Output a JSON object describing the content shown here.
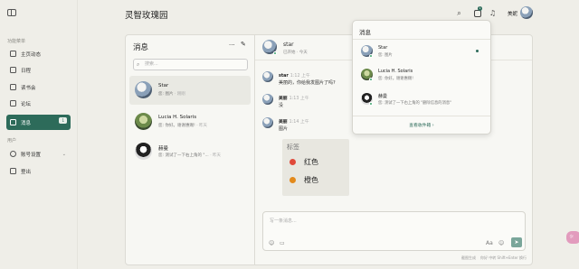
{
  "app": {
    "title": "灵智玫瑰园",
    "username": "美妮",
    "notif_count": "1"
  },
  "sidebar": {
    "section_main": "功能菜单",
    "items": [
      {
        "label": "主页动态",
        "icon": "home-icon"
      },
      {
        "label": "日程",
        "icon": "calendar-icon"
      },
      {
        "label": "读书会",
        "icon": "book-icon"
      },
      {
        "label": "论坛",
        "icon": "forum-icon"
      },
      {
        "label": "消息",
        "icon": "message-icon",
        "badge": "1",
        "active": true
      }
    ],
    "section_user": "用户",
    "user_items": [
      {
        "label": "账号设置",
        "icon": "user-settings-icon"
      },
      {
        "label": "登出",
        "icon": "logout-icon"
      }
    ]
  },
  "list": {
    "title": "消息",
    "search_placeholder": "搜索...",
    "conversations": [
      {
        "name": "Star",
        "preview": "您: 图片",
        "time": "· 刚刚"
      },
      {
        "name": "Lucia H. Solaris",
        "preview": "您: 你好。谢谢惠赐!",
        "time": "· 昨天"
      },
      {
        "name": "赫曼",
        "preview": "您: 测试了一下右上角的 \"...",
        "time": "· 昨天"
      }
    ]
  },
  "chat": {
    "name": "star",
    "status": "已开始 · 今天",
    "messages": [
      {
        "name": "star",
        "time": "1:12 上午",
        "text": "美丽的，你给我发图片了吗?"
      },
      {
        "name": "美丽",
        "time": "1:13 上午",
        "text": "没"
      },
      {
        "name": "美丽",
        "time": "1:14 上午",
        "text": "图片"
      }
    ],
    "tag_card": {
      "title": "标签",
      "tags": [
        {
          "label": "红色",
          "color": "#e04a3a"
        },
        {
          "label": "橙色",
          "color": "#e38a1c"
        }
      ]
    },
    "composer_placeholder": "写一条消息...",
    "footer_left": "截图生成",
    "footer_right": "你好 中转 Shift+Enter 换行"
  },
  "popup": {
    "title": "消息",
    "items": [
      {
        "name": "Star",
        "preview": "您: 图片",
        "unread": true
      },
      {
        "name": "Lucia H. Solaris",
        "preview": "您: 你好。谢谢惠赐!",
        "unread": false
      },
      {
        "name": "赫曼",
        "preview": "您: 测试了一下右上角的 \"删除信息的消息\"",
        "unread": false
      }
    ],
    "view_all": "查看收件箱 ›"
  }
}
